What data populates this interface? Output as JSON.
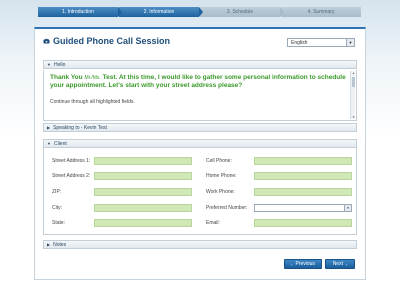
{
  "steps": [
    {
      "label": "1. Introduction",
      "state": "active"
    },
    {
      "label": "2. Information",
      "state": "active"
    },
    {
      "label": "3. Schedule",
      "state": "inactive"
    },
    {
      "label": "4. Summary",
      "state": "inactive"
    }
  ],
  "header": {
    "title": "Guided Phone Call Session",
    "language": "English",
    "phone_icon": "phone-icon"
  },
  "sections": {
    "hello": "Hello",
    "speaking": "Speaking to - Kevin Test",
    "client": "Client",
    "notes": "Notes"
  },
  "hello": {
    "line_prefix": "Thank You",
    "honorific": "Mr./Ms.",
    "line_rest": "Test. At this time, I would like to gather some personal information to schedule your appointment. Let's start with your street address please?",
    "instruction": "Continue through all highlighted fields."
  },
  "client": {
    "left_fields": [
      "Street Address 1:",
      "Street Address 2:",
      "ZIP:",
      "City:",
      "State:"
    ],
    "right_fields": [
      "Cell Phone:",
      "Home Phone:",
      "Work Phone:",
      "Preferred Number:",
      "Email:"
    ]
  },
  "buttons": {
    "previous": "Previous",
    "next": "Next"
  },
  "colors": {
    "accent": "#1e62a0",
    "highlight_field": "#cfe8b5",
    "hello_text": "#3a9a2a"
  }
}
